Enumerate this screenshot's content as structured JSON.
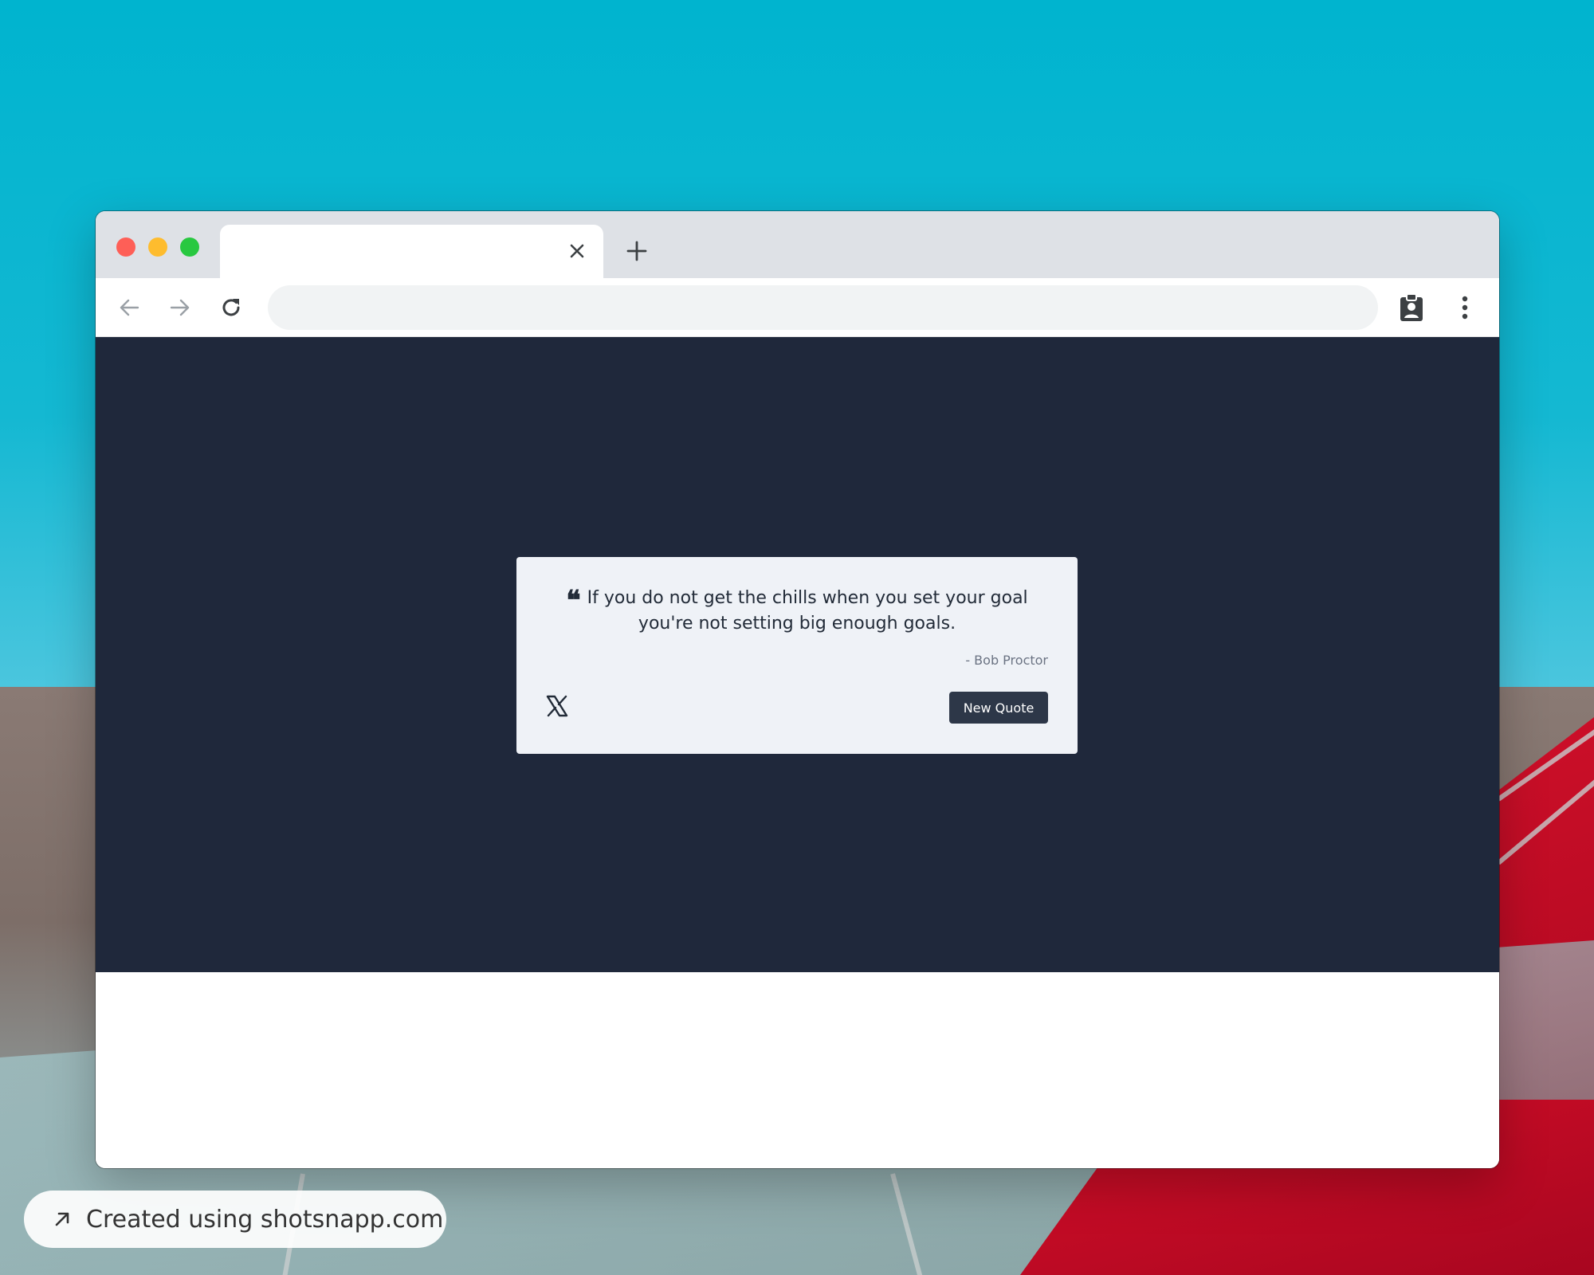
{
  "browser": {
    "tab": {
      "title": "",
      "close_icon": "close-icon"
    },
    "new_tab_icon": "plus-icon",
    "toolbar": {
      "back_icon": "arrow-left-icon",
      "forward_icon": "arrow-right-icon",
      "reload_icon": "reload-icon",
      "address_value": "",
      "extension_icon": "clipboard-account-icon",
      "menu_icon": "kebab-menu-icon"
    }
  },
  "quote_card": {
    "quote_icon": "quote-left-icon",
    "quote_text": "If you do not get the chills when you set your goal you're not setting big enough goals.",
    "author": "- Bob Proctor",
    "share_icon": "x-twitter-icon",
    "new_quote_label": "New Quote"
  },
  "watermark": {
    "icon": "arrow-up-right-icon",
    "text": "Created using shotsnapp.com"
  },
  "colors": {
    "page_background": "#1f283b",
    "card_background": "#eff2f7",
    "button_background": "#2d3748",
    "button_text": "#ffffff"
  }
}
